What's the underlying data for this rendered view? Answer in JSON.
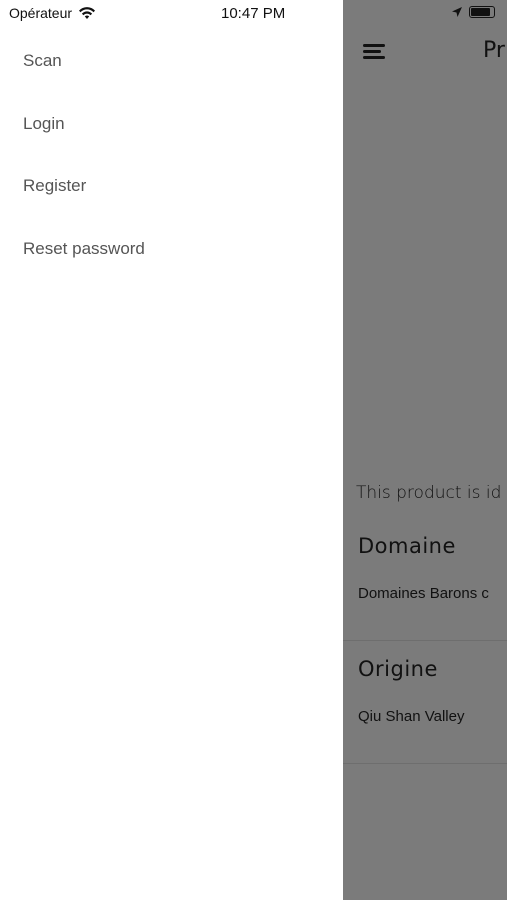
{
  "status": {
    "carrier": "Opérateur",
    "time": "10:47 PM"
  },
  "drawer": {
    "items": [
      {
        "label": "Scan"
      },
      {
        "label": "Login"
      },
      {
        "label": "Register"
      },
      {
        "label": "Reset password"
      }
    ]
  },
  "main": {
    "title": "Pr",
    "description": "This product is id",
    "sections": [
      {
        "title": "Domaine",
        "value": "Domaines Barons c"
      },
      {
        "title": "Origine",
        "value": "Qiu Shan Valley"
      }
    ]
  },
  "colors": {
    "overlay": "#7b7b7b",
    "drawer_bg": "#ffffff",
    "menu_text": "#555555"
  }
}
